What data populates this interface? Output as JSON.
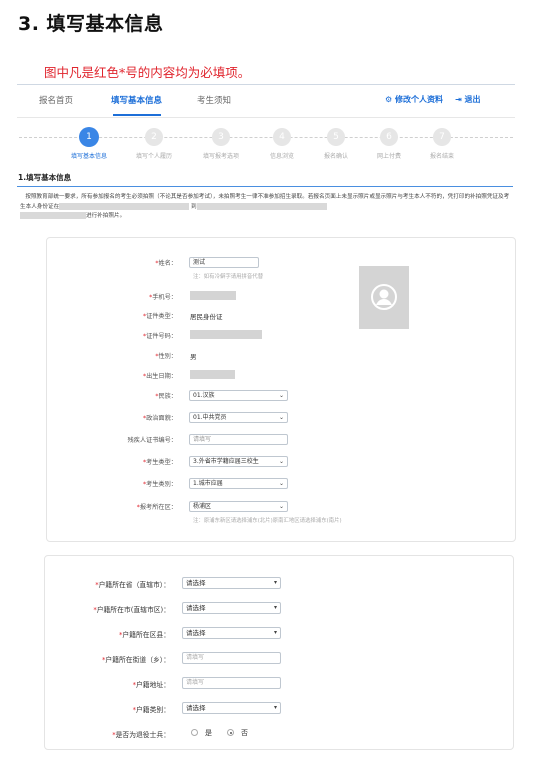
{
  "heading": "3. 填写基本信息",
  "note": "图中凡是红色*号的内容均为必填项。",
  "nav": {
    "home": "报名首页",
    "basic": "填写基本信息",
    "notice": "考生须知",
    "modify": "修改个人资料",
    "logout": "退出"
  },
  "steps": [
    {
      "num": "1",
      "label": "填写基本信息"
    },
    {
      "num": "2",
      "label": "填写个人履历"
    },
    {
      "num": "3",
      "label": "填写报考选项"
    },
    {
      "num": "4",
      "label": "信息浏览"
    },
    {
      "num": "5",
      "label": "报名确认"
    },
    {
      "num": "6",
      "label": "网上付费"
    },
    {
      "num": "7",
      "label": "报名结束"
    }
  ],
  "section_title": "1.填写基本信息",
  "paragraph": {
    "p1": "按照教育部统一要求，所有参加报名的考生必须拍照（不论其是否参加考试），未拍照考生一律不准参加招生录取。若报名页面上未显示照片或显示照片与考生本人不符的，凭打印的补拍照凭证及考生本人身份证在",
    "p2": "到",
    "p3": "进行补拍照片。"
  },
  "form1": {
    "name_label": "姓名：",
    "name_value": "测试",
    "name_hint": "注：如有冷僻字请用拼音代替",
    "phone_label": "手机号：",
    "idtype_label": "证件类型：",
    "idtype_value": "居民身份证",
    "idnum_label": "证件号码：",
    "gender_label": "性别：",
    "gender_value": "男",
    "birth_label": "出生日期：",
    "nation_label": "民族：",
    "nation_value": "01.汉族",
    "political_label": "政治面貌：",
    "political_value": "01.中共党员",
    "disability_label": "残疾人证书编号：",
    "disability_placeholder": "请填写",
    "examtype_label": "考生类型：",
    "examtype_value": "3.外省市学籍应届三校生",
    "category_label": "考生类别：",
    "category_value": "1.城市应届",
    "district_label": "报考所在区：",
    "district_value": "杨浦区",
    "district_hint": "注：原浦东新区请选择浦东(北片)原南汇地区请选择浦东(南片)"
  },
  "form2": {
    "province_label": "户籍所在省（直辖市）：",
    "province_value": "请选择",
    "city_label": "户籍所在市(直辖市区)：",
    "city_value": "请选择",
    "county_label": "户籍所在区县：",
    "county_value": "请选择",
    "street_label": "户籍所在街道（乡）：",
    "street_placeholder": "请填写",
    "address_label": "户籍地址：",
    "address_placeholder": "请填写",
    "hukou_type_label": "户籍类别：",
    "hukou_type_value": "请选择",
    "veteran_label": "是否为退役士兵：",
    "veteran_yes": "是",
    "veteran_no": "否"
  },
  "colors": {
    "accent": "#1d6fd8",
    "required": "#e0242d",
    "step_active": "#3a86e6"
  }
}
